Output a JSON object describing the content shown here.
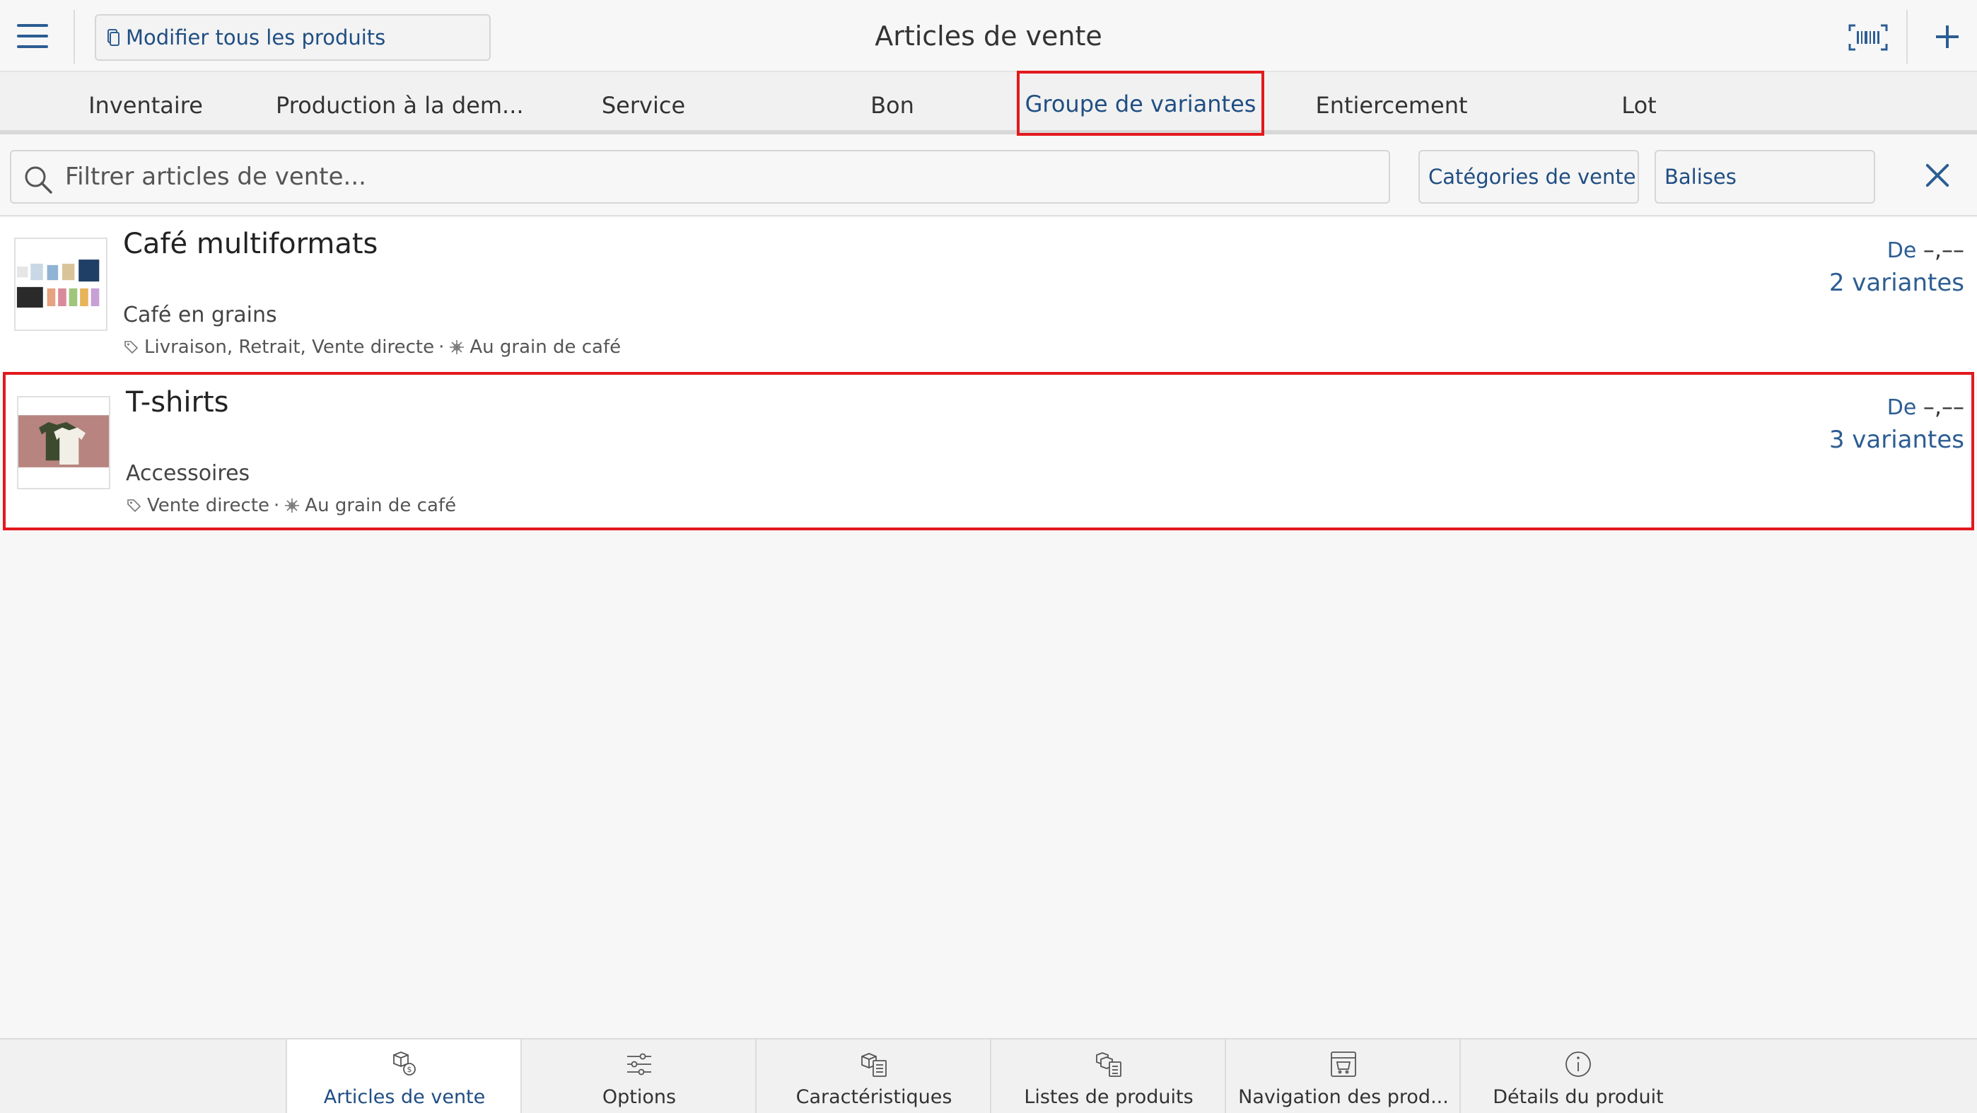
{
  "header": {
    "title": "Articles de vente",
    "edit_all_label": "Modifier tous les produits",
    "menu_icon": "hamburger-menu-icon",
    "barcode_icon": "barcode-icon",
    "add_icon": "plus-icon"
  },
  "tabs": [
    {
      "label": "Inventaire",
      "active": false
    },
    {
      "label": "Production à la dem...",
      "active": false
    },
    {
      "label": "Service",
      "active": false
    },
    {
      "label": "Bon",
      "active": false
    },
    {
      "label": "Groupe de variantes",
      "active": true
    },
    {
      "label": "Entiercement",
      "active": false
    },
    {
      "label": "Lot",
      "active": false
    }
  ],
  "filter": {
    "placeholder": "Filtrer articles de vente...",
    "categories_label": "Catégories de vente",
    "tags_label": "Balises"
  },
  "items": [
    {
      "name": "Café multiformats",
      "category": "Café en grains",
      "channels": "Livraison, Retrait, Vente directe",
      "separator": "·",
      "location": "Au grain de café",
      "price_prefix": "De",
      "price": "–,––",
      "variants": "2 variantes",
      "highlighted": false
    },
    {
      "name": "T-shirts",
      "category": "Accessoires",
      "channels": "Vente directe",
      "separator": "·",
      "location": "Au grain de café",
      "price_prefix": "De",
      "price": "–,––",
      "variants": "3 variantes",
      "highlighted": true
    }
  ],
  "bottom_nav": [
    {
      "label": "Articles de vente",
      "icon": "boxes-dollar-icon",
      "active": true
    },
    {
      "label": "Options",
      "icon": "sliders-icon",
      "active": false
    },
    {
      "label": "Caractéristiques",
      "icon": "box-list-icon",
      "active": false
    },
    {
      "label": "Listes de produits",
      "icon": "boxes-list-icon",
      "active": false
    },
    {
      "label": "Navigation des prod...",
      "icon": "storefront-icon",
      "active": false
    },
    {
      "label": "Détails du produit",
      "icon": "info-icon",
      "active": false
    }
  ],
  "colors": {
    "accent": "#1f4e83",
    "icon": "#2c5d93",
    "highlight": "#e3191e",
    "background": "#f7f7f7"
  }
}
